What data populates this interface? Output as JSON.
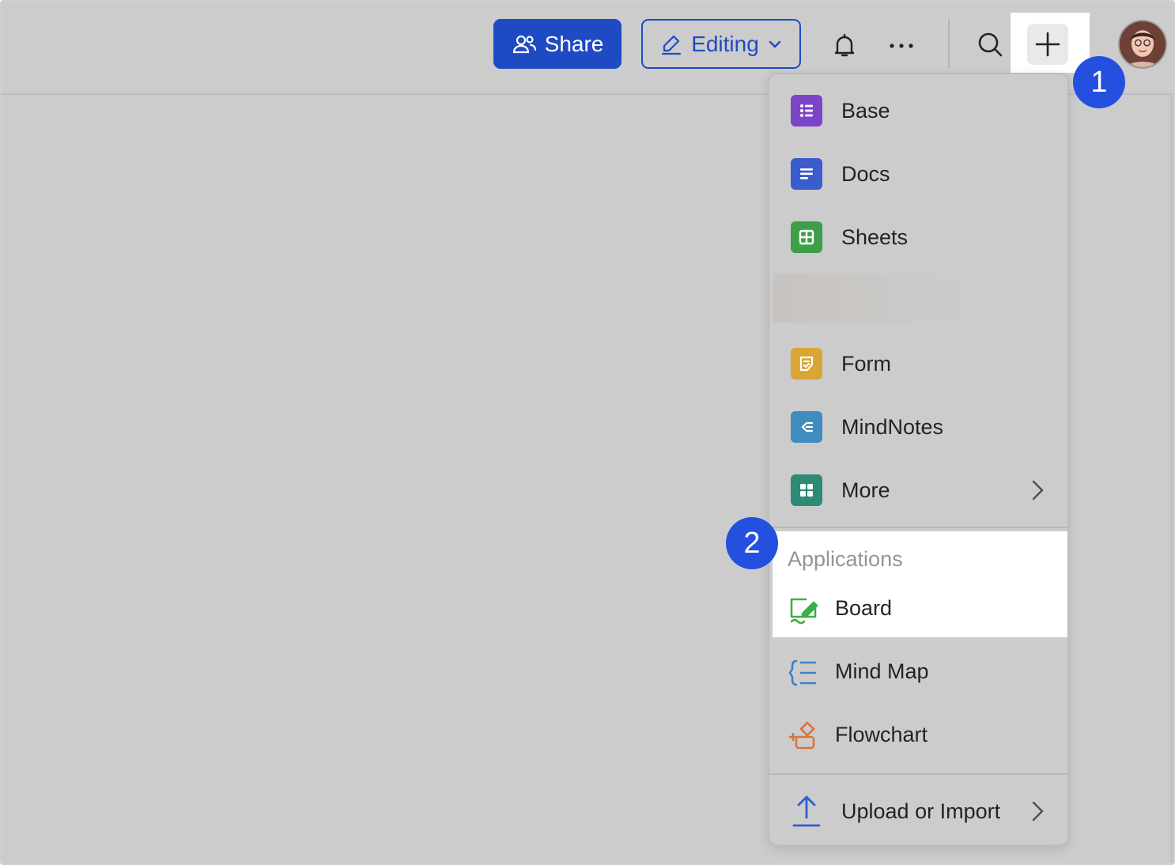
{
  "toolbar": {
    "share_label": "Share",
    "editing_label": "Editing",
    "icons": {
      "share": "people-icon",
      "editing": "pencil-icon",
      "bell": "bell-icon",
      "more": "ellipsis-icon",
      "search": "search-icon",
      "create": "plus-icon"
    },
    "accent_color": "#1e4bc4"
  },
  "steps": [
    "1",
    "2"
  ],
  "menu": {
    "items": [
      {
        "label": "Base",
        "icon": "base-icon",
        "color": "#7c45c8"
      },
      {
        "label": "Docs",
        "icon": "docs-icon",
        "color": "#3a5ccc"
      },
      {
        "label": "Sheets",
        "icon": "sheets-icon",
        "color": "#3e9e4a"
      },
      {
        "label": "Form",
        "icon": "form-icon",
        "color": "#d9a535"
      },
      {
        "label": "MindNotes",
        "icon": "mindnotes-icon",
        "color": "#3f8cbf"
      },
      {
        "label": "More",
        "icon": "grid-icon",
        "color": "#2e8a76"
      }
    ],
    "applications": {
      "title": "Applications",
      "items": [
        {
          "label": "Board",
          "icon": "board-icon",
          "color": "#3fae4a"
        },
        {
          "label": "Mind Map",
          "icon": "mindmap-icon",
          "color": "#3a83c4"
        },
        {
          "label": "Flowchart",
          "icon": "flowchart-icon",
          "color": "#d9743a"
        }
      ]
    },
    "upload": {
      "label": "Upload or Import",
      "icon": "upload-icon",
      "color": "#2c5fd4"
    }
  }
}
